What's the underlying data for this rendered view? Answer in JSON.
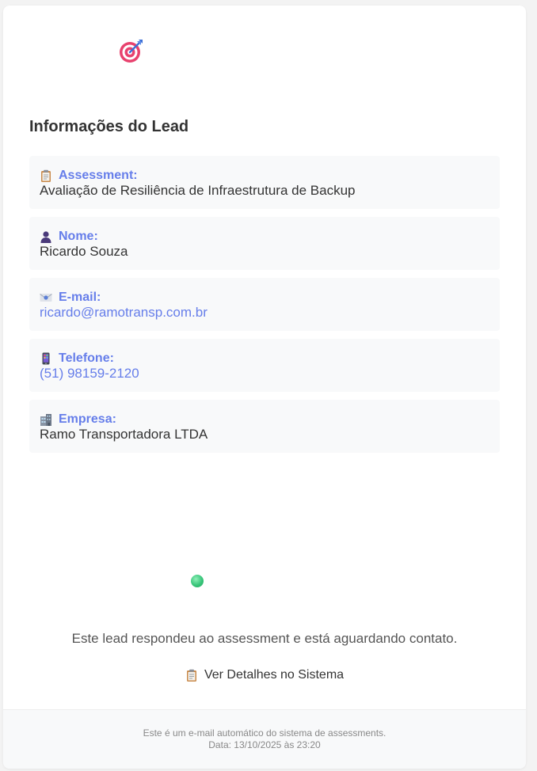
{
  "header": {
    "icon": "target-icon"
  },
  "lead": {
    "title": "Informações do Lead",
    "fields": [
      {
        "icon": "clipboard-icon",
        "label": "Assessment:",
        "value": "Avaliação de Resiliência de Infraestrutura de Backup"
      },
      {
        "icon": "person-icon",
        "label": "Nome:",
        "value": "Ricardo Souza"
      },
      {
        "icon": "email-icon",
        "label": "E-mail:",
        "value": "ricardo@ramotransp.com.br"
      },
      {
        "icon": "phone-icon",
        "label": "Telefone:",
        "value": "(51) 98159-2120"
      },
      {
        "icon": "building-icon",
        "label": "Empresa:",
        "value": "Ramo Transportadora LTDA"
      }
    ]
  },
  "status": {
    "icon": "green-circle-icon",
    "message": "Este lead respondeu ao assessment e está aguardando contato."
  },
  "action": {
    "icon": "clipboard-icon",
    "label": "Ver Detalhes no Sistema"
  },
  "footer": {
    "line1": "Este é um e-mail automático do sistema de assessments.",
    "line2": "Data: 13/10/2025 às 23:20"
  },
  "colors": {
    "accent": "#667eea",
    "text": "#333333",
    "field_bg": "#f8f9fa",
    "status_green": "#39c57a"
  }
}
